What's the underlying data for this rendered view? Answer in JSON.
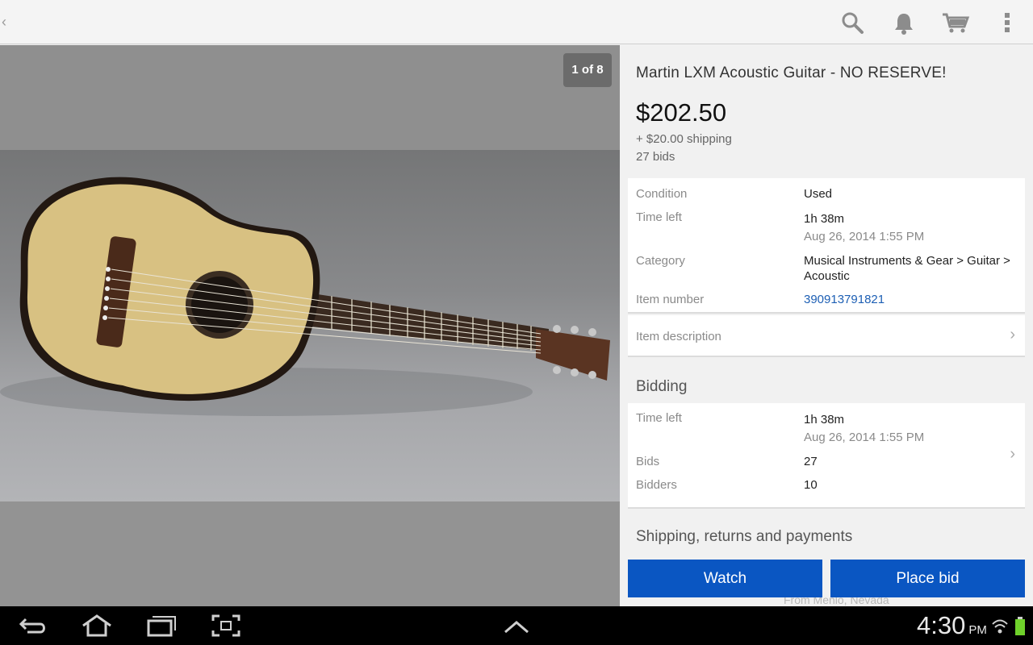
{
  "header": {
    "back_icon": "chevron-left-icon",
    "actions": [
      "search-icon",
      "bell-icon",
      "cart-icon",
      "overflow-menu-icon"
    ]
  },
  "gallery": {
    "counter": "1 of 8",
    "image": "acoustic-guitar-photo"
  },
  "item": {
    "title": "Martin LXM Acoustic Guitar - NO RESERVE!",
    "price": "$202.50",
    "shipping": "+ $20.00 shipping",
    "bids": "27 bids"
  },
  "details": {
    "condition_label": "Condition",
    "condition_value": "Used",
    "time_left_label": "Time left",
    "time_left_value": "1h 38m",
    "time_left_date": "Aug 26, 2014 1:55 PM",
    "category_label": "Category",
    "category_line1": "Musical Instruments & Gear > Guitar >",
    "category_line2": "Acoustic",
    "item_number_label": "Item number",
    "item_number_value": "390913791821",
    "description_label": "Item description"
  },
  "bidding": {
    "heading": "Bidding",
    "time_left_label": "Time left",
    "time_left_value": "1h 38m",
    "time_left_date": "Aug 26, 2014 1:55 PM",
    "bids_label": "Bids",
    "bids_value": "27",
    "bidders_label": "Bidders",
    "bidders_value": "10"
  },
  "shipping_section": {
    "heading": "Shipping, returns and payments",
    "partial_text": "From Menlo, Nevada"
  },
  "buttons": {
    "watch": "Watch",
    "place_bid": "Place bid"
  },
  "colors": {
    "accent": "#0a56c2",
    "link": "#1d5fb4"
  },
  "system": {
    "time": "4:30",
    "ampm": "PM"
  }
}
